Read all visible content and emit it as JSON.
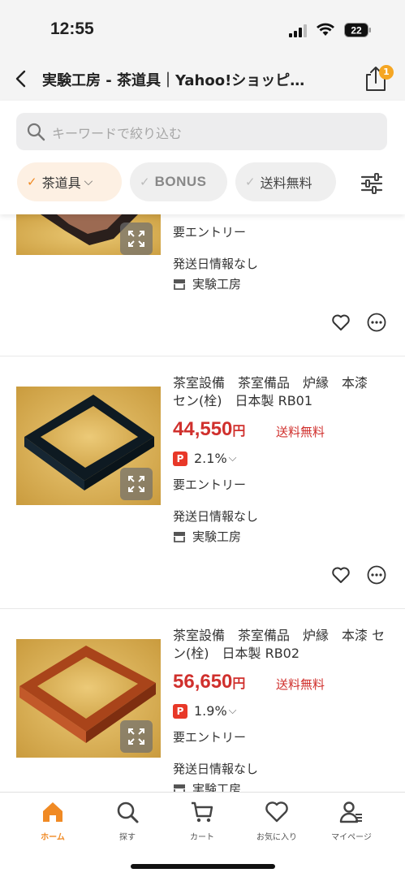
{
  "status_bar": {
    "time": "12:55",
    "battery": "22"
  },
  "header": {
    "title": "実験工房 - 茶道具｜Yahoo!ショッピ…"
  },
  "search": {
    "placeholder": "キーワードで絞り込む"
  },
  "filters": {
    "category": {
      "check": "✓",
      "label": "茶道具",
      "chevron": "⌵"
    },
    "bonus": {
      "check": "✓",
      "label": "BONUS"
    },
    "free_shipping": {
      "check": "✓",
      "label": "送料無料"
    },
    "settings_badge": "1"
  },
  "products": [
    {
      "title": "",
      "entry": "要エントリー",
      "delivery": "発送日情報なし",
      "store": "実験工房"
    },
    {
      "title": "茶室設備　茶室備品　炉縁　本漆　セン(栓)　日本製 RB01",
      "price": "44,550",
      "price_unit": "円",
      "shipping": "送料無料",
      "points": "2.1%",
      "points_chevron": "⌵",
      "entry": "要エントリー",
      "delivery": "発送日情報なし",
      "store": "実験工房"
    },
    {
      "title": "茶室設備　茶室備品　炉縁　本漆 セン(栓)　日本製 RB02",
      "price": "56,650",
      "price_unit": "円",
      "shipping": "送料無料",
      "points": "1.9%",
      "points_chevron": "⌵",
      "entry": "要エントリー",
      "delivery": "発送日情報なし",
      "store": "実験工房"
    }
  ],
  "paypay_icon": "P",
  "tabs": [
    {
      "label": "ホーム",
      "icon": "home-icon",
      "active": true
    },
    {
      "label": "探す",
      "icon": "search-icon"
    },
    {
      "label": "カート",
      "icon": "cart-icon"
    },
    {
      "label": "お気に入り",
      "icon": "heart-icon"
    },
    {
      "label": "マイページ",
      "icon": "user-icon"
    }
  ],
  "colors": {
    "accent": "#f08a24",
    "price": "#d0302d",
    "paypay": "#e83828"
  }
}
